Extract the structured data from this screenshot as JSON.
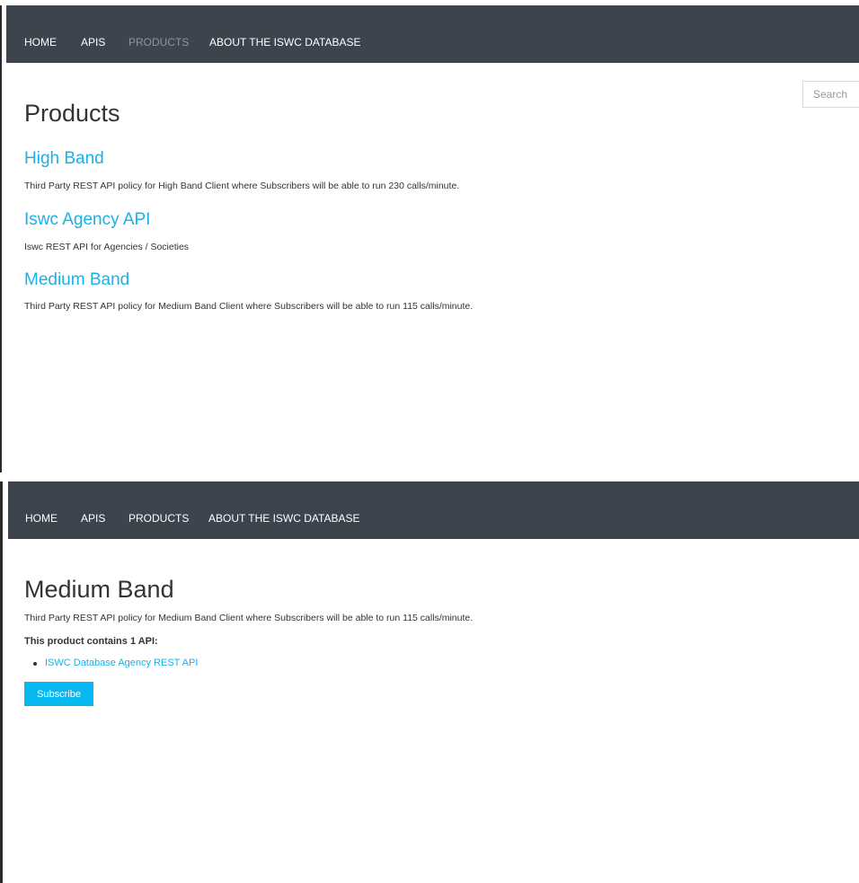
{
  "products_page": {
    "nav": [
      {
        "label": "HOME"
      },
      {
        "label": "APIS"
      },
      {
        "label": "PRODUCTS"
      },
      {
        "label": "ABOUT THE ISWC DATABASE"
      }
    ],
    "search_placeholder": "Search",
    "title": "Products",
    "products": [
      {
        "name": "High Band",
        "description": "Third Party REST API policy for High Band Client where Subscribers will be able to run 230 calls/minute."
      },
      {
        "name": "Iswc Agency API",
        "description": "Iswc REST API for Agencies / Societies"
      },
      {
        "name": "Medium Band",
        "description": "Third Party REST API policy for Medium Band Client where Subscribers will be able to run 115 calls/minute."
      }
    ]
  },
  "product_detail_page": {
    "nav": [
      {
        "label": "HOME"
      },
      {
        "label": "APIS"
      },
      {
        "label": "PRODUCTS"
      },
      {
        "label": "ABOUT THE ISWC DATABASE"
      }
    ],
    "title": "Medium Band",
    "description": "Third Party REST API policy for Medium Band Client where Subscribers will be able to run 115 calls/minute.",
    "contains_label": "This product contains 1 API:",
    "apis": [
      {
        "name": "ISWC Database Agency REST API"
      }
    ],
    "subscribe_label": "Subscribe"
  },
  "colors": {
    "navbar_bg": "#3c444e",
    "link": "#1ab0e8",
    "active_nav": "#8c95a0",
    "button": "#06b8ef"
  }
}
